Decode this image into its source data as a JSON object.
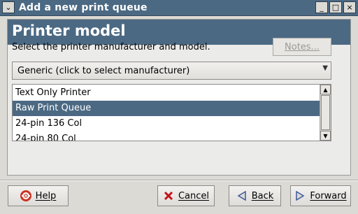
{
  "window": {
    "title": "Add a new print queue",
    "menu_glyph": "⌄",
    "minimize_glyph": "_",
    "maximize_glyph": "□",
    "close_glyph": "×"
  },
  "header": {
    "title": "Printer model"
  },
  "main": {
    "instruction": "Select the printer manufacturer and model.",
    "notes_label": "Notes...",
    "manufacturer": {
      "value": "Generic (click to select manufacturer)"
    },
    "models": [
      {
        "label": "Text Only Printer",
        "selected": false
      },
      {
        "label": "Raw Print Queue",
        "selected": true
      },
      {
        "label": "24-pin 136 Col",
        "selected": false
      },
      {
        "label": "24-pin 80 Col",
        "selected": false
      }
    ]
  },
  "footer": {
    "help_label": "Help",
    "cancel_label": "Cancel",
    "back_label": "Back",
    "forward_label": "Forward"
  },
  "colors": {
    "accent": "#4b6983",
    "cancel_red": "#c4121a",
    "help_icon": "#cc3322",
    "nav_arrow": "#3d5a9a"
  },
  "icons": {
    "window_menu": "chevron-down-icon",
    "help": "lifebuoy-icon",
    "cancel": "x-icon",
    "back": "arrow-left-icon",
    "forward": "arrow-right-icon"
  }
}
